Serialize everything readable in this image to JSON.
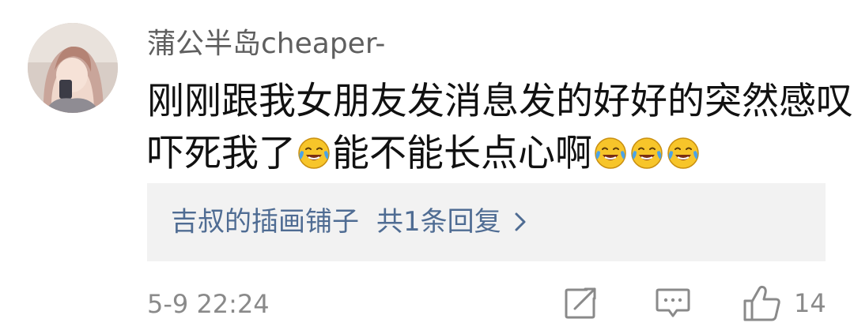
{
  "comment": {
    "username": "蒲公半岛cheaper-",
    "content_line1": "刚刚跟我女朋友发消息发的好好的突然感叹号",
    "content_line2_a": "吓死我了",
    "content_line2_b": "能不能长点心啊",
    "emoji": "laugh-cry-emoji",
    "reply_author": "吉叔的插画铺子",
    "reply_count_text": "共1条回复",
    "timestamp": "5-9 22:24",
    "like_count": "14"
  },
  "icons": {
    "share": "share-icon",
    "comment": "comment-icon",
    "like": "thumbs-up-icon",
    "chevron": "chevron-right-icon"
  },
  "colors": {
    "username": "#5f5f5f",
    "text": "#111111",
    "link": "#4f6c93",
    "meta": "#8a8a8a",
    "reply_bg": "#f2f2f2",
    "emoji_face": "#f7c52a",
    "emoji_tear": "#4aa3e8"
  }
}
